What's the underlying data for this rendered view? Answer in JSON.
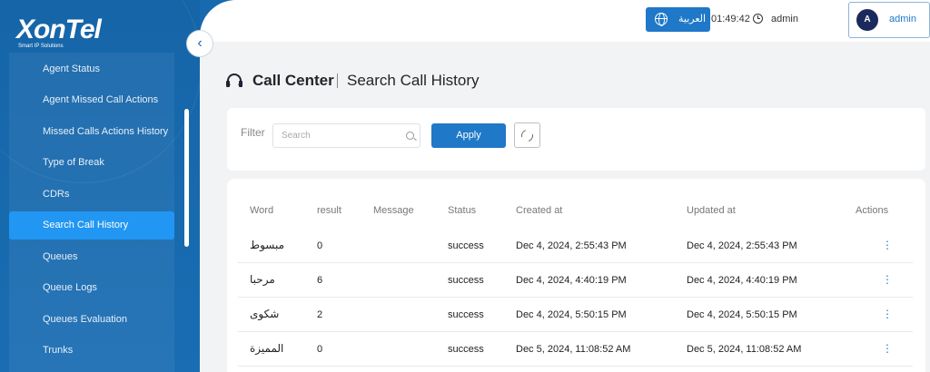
{
  "brand": {
    "name": "XonTel",
    "tagline": "Smart IP Solutions"
  },
  "sidebar": {
    "items": [
      {
        "label": "Agent Status",
        "active": false
      },
      {
        "label": "Agent Missed Call Actions",
        "active": false
      },
      {
        "label": "Missed Calls Actions History",
        "active": false
      },
      {
        "label": "Type of Break",
        "active": false
      },
      {
        "label": "CDRs",
        "active": false
      },
      {
        "label": "Search Call History",
        "active": true
      },
      {
        "label": "Queues",
        "active": false
      },
      {
        "label": "Queue Logs",
        "active": false
      },
      {
        "label": "Queues Evaluation",
        "active": false
      },
      {
        "label": "Trunks",
        "active": false
      }
    ]
  },
  "header": {
    "collapse_icon": "chevron-left-icon",
    "language_label": "العربية",
    "time": "01:49:42",
    "username": "admin",
    "avatar_initial": "A",
    "profile_name": "admin"
  },
  "page": {
    "title": "Call Center",
    "subtitle": "Search Call History"
  },
  "filter": {
    "label": "Filter",
    "search_placeholder": "Search",
    "search_value": "",
    "apply_label": "Apply"
  },
  "table": {
    "columns": {
      "word": "Word",
      "result": "result",
      "message": "Message",
      "status": "Status",
      "created": "Created at",
      "updated": "Updated at",
      "actions": "Actions"
    },
    "rows": [
      {
        "word": "مبسوط",
        "result": "0",
        "message": "",
        "status": "success",
        "created": "Dec 4, 2024, 2:55:43 PM",
        "updated": "Dec 4, 2024, 2:55:43 PM"
      },
      {
        "word": "مرحبا",
        "result": "6",
        "message": "",
        "status": "success",
        "created": "Dec 4, 2024, 4:40:19 PM",
        "updated": "Dec 4, 2024, 4:40:19 PM"
      },
      {
        "word": "شكوى",
        "result": "2",
        "message": "",
        "status": "success",
        "created": "Dec 4, 2024, 5:50:15 PM",
        "updated": "Dec 4, 2024, 5:50:15 PM"
      },
      {
        "word": "المميزة",
        "result": "0",
        "message": "",
        "status": "success",
        "created": "Dec 5, 2024, 11:08:52 AM",
        "updated": "Dec 5, 2024, 11:08:52 AM"
      }
    ]
  }
}
